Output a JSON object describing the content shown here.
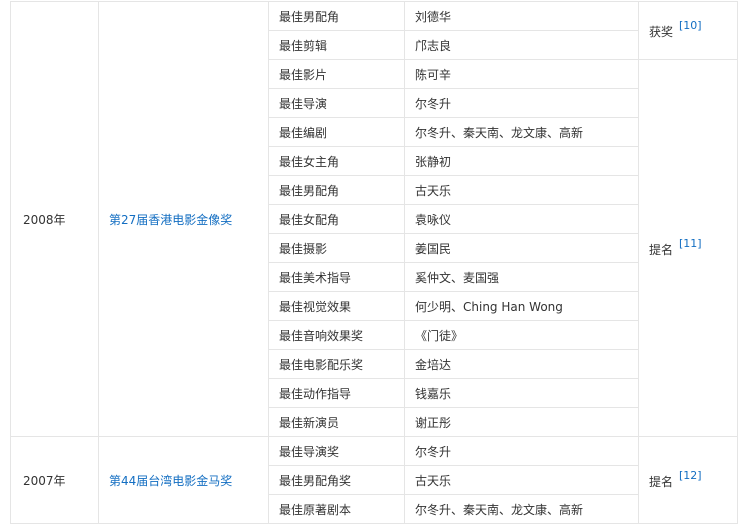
{
  "groups": [
    {
      "year": "2008年",
      "event": "第27届香港电影金像奖",
      "rows": [
        {
          "category": "最佳男配角",
          "nominee": "刘德华"
        },
        {
          "category": "最佳剪辑",
          "nominee": "邝志良"
        },
        {
          "category": "最佳影片",
          "nominee": "陈可辛"
        },
        {
          "category": "最佳导演",
          "nominee": "尔冬升"
        },
        {
          "category": "最佳编剧",
          "nominee": "尔冬升、秦天南、龙文康、高新"
        },
        {
          "category": "最佳女主角",
          "nominee": "张静初"
        },
        {
          "category": "最佳男配角",
          "nominee": "古天乐"
        },
        {
          "category": "最佳女配角",
          "nominee": "袁咏仪"
        },
        {
          "category": "最佳摄影",
          "nominee": "姜国民"
        },
        {
          "category": "最佳美术指导",
          "nominee": "奚仲文、麦国强"
        },
        {
          "category": "最佳视觉效果",
          "nominee": "何少明、Ching Han Wong"
        },
        {
          "category": "最佳音响效果奖",
          "nominee": "《门徒》"
        },
        {
          "category": "最佳电影配乐奖",
          "nominee": "金培达"
        },
        {
          "category": "最佳动作指导",
          "nominee": "钱嘉乐"
        },
        {
          "category": "最佳新演员",
          "nominee": "谢正彤"
        }
      ],
      "results": [
        {
          "text": "获奖",
          "ref": "[10]"
        },
        {
          "text": "提名",
          "ref": "[11]"
        }
      ]
    },
    {
      "year": "2007年",
      "event": "第44届台湾电影金马奖",
      "rows": [
        {
          "category": "最佳导演奖",
          "nominee": "尔冬升"
        },
        {
          "category": "最佳男配角奖",
          "nominee": "古天乐"
        },
        {
          "category": "最佳原著剧本",
          "nominee": "尔冬升、秦天南、龙文康、高新"
        }
      ],
      "results": [
        {
          "text": "提名",
          "ref": "[12]"
        }
      ]
    }
  ]
}
